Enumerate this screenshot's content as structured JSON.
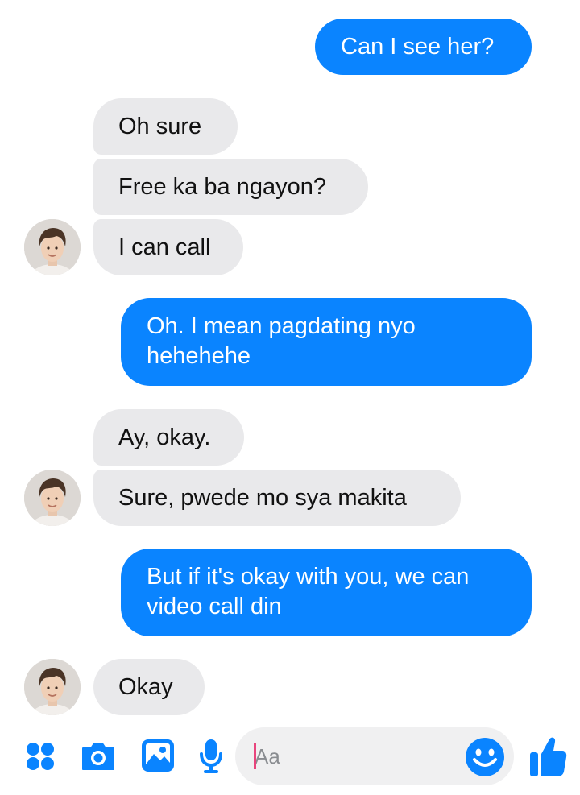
{
  "messages": [
    {
      "side": "out",
      "text": "Can I see her?"
    },
    {
      "side": "in",
      "text": "Oh sure"
    },
    {
      "side": "in",
      "text": "Free ka ba ngayon?"
    },
    {
      "side": "in",
      "text": "I can call"
    },
    {
      "side": "out",
      "text": "Oh. I mean pagdating nyo hehehehe"
    },
    {
      "side": "in",
      "text": "Ay, okay."
    },
    {
      "side": "in",
      "text": "Sure, pwede mo sya makita"
    },
    {
      "side": "out",
      "text": "But if it's okay with you, we can video call din"
    },
    {
      "side": "in",
      "text": "Okay"
    }
  ],
  "composer": {
    "placeholder": "Aa",
    "icons": [
      "menu-dots-icon",
      "camera-icon",
      "image-icon",
      "microphone-icon",
      "emoji-icon",
      "thumbs-up-icon"
    ]
  },
  "colors": {
    "outgoing_bubble": "#0a84ff",
    "incoming_bubble": "#e9e9eb",
    "icon_blue": "#0a84ff"
  }
}
